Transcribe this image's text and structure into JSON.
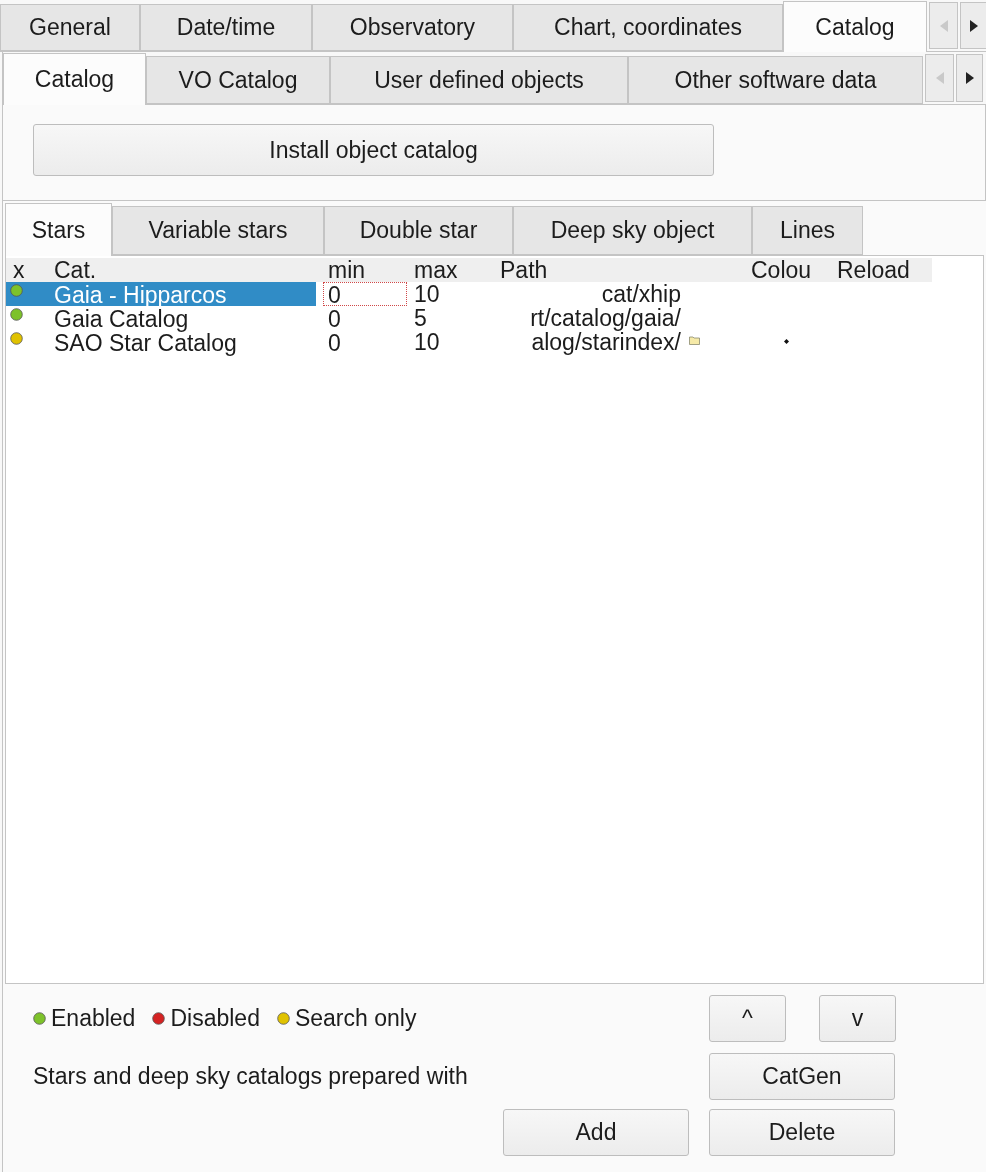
{
  "main_tabs": {
    "items": [
      {
        "label": "General",
        "selected": false
      },
      {
        "label": "Date/time",
        "selected": false
      },
      {
        "label": "Observatory",
        "selected": false
      },
      {
        "label": "Chart, coordinates",
        "selected": false
      },
      {
        "label": "Catalog",
        "selected": true
      }
    ],
    "scroll_left_disabled": true
  },
  "sub_tabs": {
    "items": [
      {
        "label": "Catalog",
        "selected": true
      },
      {
        "label": "VO Catalog",
        "selected": false
      },
      {
        "label": "User defined objects",
        "selected": false
      },
      {
        "label": "Other software data",
        "selected": false
      }
    ],
    "scroll_left_disabled": true
  },
  "install_button": "Install object catalog",
  "catalog_tabs": [
    {
      "label": "Stars",
      "selected": true
    },
    {
      "label": "Variable stars",
      "selected": false
    },
    {
      "label": "Double star",
      "selected": false
    },
    {
      "label": "Deep sky object",
      "selected": false
    },
    {
      "label": "Lines",
      "selected": false
    }
  ],
  "table": {
    "columns": [
      "x",
      "Cat.",
      "min",
      "max",
      "Path",
      "Colou",
      "Reload"
    ],
    "rows": [
      {
        "color": "#7dc22a",
        "selected": true,
        "min_focused": true,
        "cat": "Gaia - Hipparcos",
        "min": "0",
        "max": "10",
        "path": "cat/xhip",
        "browse_button": false,
        "colour_marker": false
      },
      {
        "color": "#7dc22a",
        "selected": false,
        "min_focused": false,
        "cat": "Gaia Catalog",
        "min": "0",
        "max": "5",
        "path": "rt/catalog/gaia/",
        "browse_button": false,
        "colour_marker": false
      },
      {
        "color": "#e0c200",
        "selected": false,
        "min_focused": false,
        "cat": "SAO Star Catalog",
        "min": "0",
        "max": "10",
        "path": "alog/starindex/",
        "browse_button": true,
        "colour_marker": true
      }
    ]
  },
  "legend": [
    {
      "color": "#7dc22a",
      "label": "Enabled"
    },
    {
      "color": "#d42222",
      "label": "Disabled"
    },
    {
      "color": "#e0c200",
      "label": "Search only"
    }
  ],
  "move_buttons": [
    "^",
    "v"
  ],
  "catgen_note": "Stars and deep sky catalogs prepared with",
  "catgen_button": "CatGen",
  "buttons": [
    "Add",
    "Delete"
  ]
}
